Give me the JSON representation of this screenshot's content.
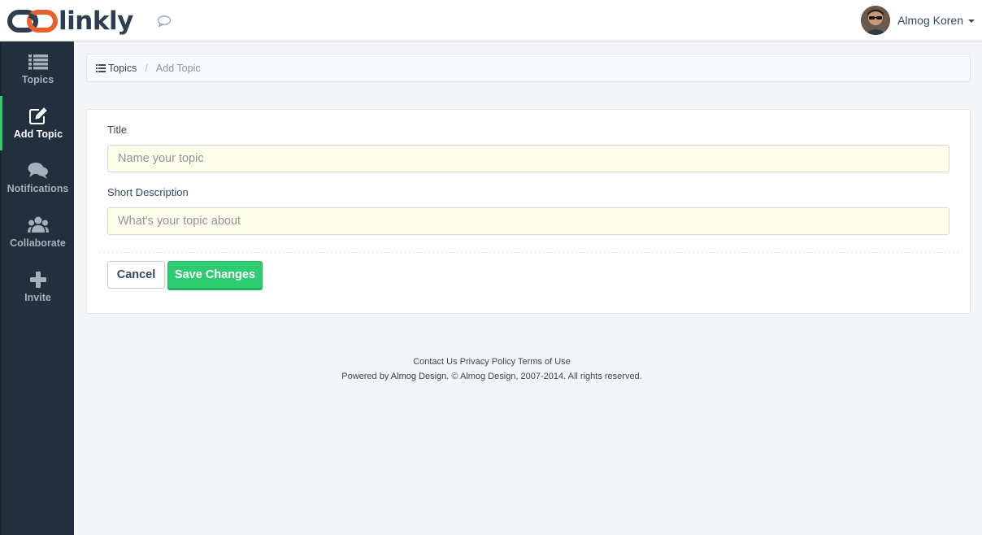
{
  "header": {
    "logo_text": "linkly",
    "user": {
      "name": "Almog Koren"
    }
  },
  "sidebar": {
    "items": [
      {
        "label": "Topics",
        "icon": "list-icon",
        "active": false
      },
      {
        "label": "Add Topic",
        "icon": "edit-icon",
        "active": true
      },
      {
        "label": "Notifications",
        "icon": "comments-icon",
        "active": false
      },
      {
        "label": "Collaborate",
        "icon": "users-icon",
        "active": false
      },
      {
        "label": "Invite",
        "icon": "plus-icon",
        "active": false
      }
    ]
  },
  "breadcrumb": {
    "parent": "Topics",
    "separator": "/",
    "current": "Add Topic"
  },
  "form": {
    "title_label": "Title",
    "title_placeholder": "Name your topic",
    "title_value": "",
    "description_label": "Short Description",
    "description_placeholder": "What's your topic about",
    "description_value": "",
    "cancel_label": "Cancel",
    "save_label": "Save Changes"
  },
  "footer": {
    "links": [
      "Contact Us",
      "Privacy Policy",
      "Terms of Use"
    ],
    "powered_prefix": "Powered by ",
    "powered_link": "Almog Design",
    "copyright": ". © Almog Design, 2007-2014. All rights reserved."
  },
  "colors": {
    "sidebar_bg": "#22303e",
    "accent": "#2ecc71",
    "logo_orange": "#e8602c",
    "text_dark": "#34495e",
    "input_bg": "#fdfee9"
  }
}
